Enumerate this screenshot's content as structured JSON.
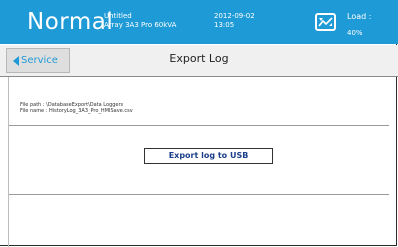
{
  "header": {
    "mode": "Normal",
    "device_name": "Untitled",
    "device_model": "Array 3A3 Pro 60kVA",
    "date": "2012-09-02",
    "time": "13:05",
    "load_label": "Load :",
    "load_value": "40%",
    "load_icon": "load-gauge-icon",
    "colors": {
      "header_bg": "#1e9ad6",
      "accent": "#1e9ad6",
      "button_text": "#1b3f8a"
    }
  },
  "nav": {
    "back_label": "Service",
    "back_icon": "back-arrow-icon",
    "title": "Export Log"
  },
  "content": {
    "file_path": "File path : \\DatabaseExport\\Data Loggers",
    "file_name": "File name : HistoryLog_3A3_Pro_HMISave.csv",
    "export_button": "Export log to USB"
  }
}
